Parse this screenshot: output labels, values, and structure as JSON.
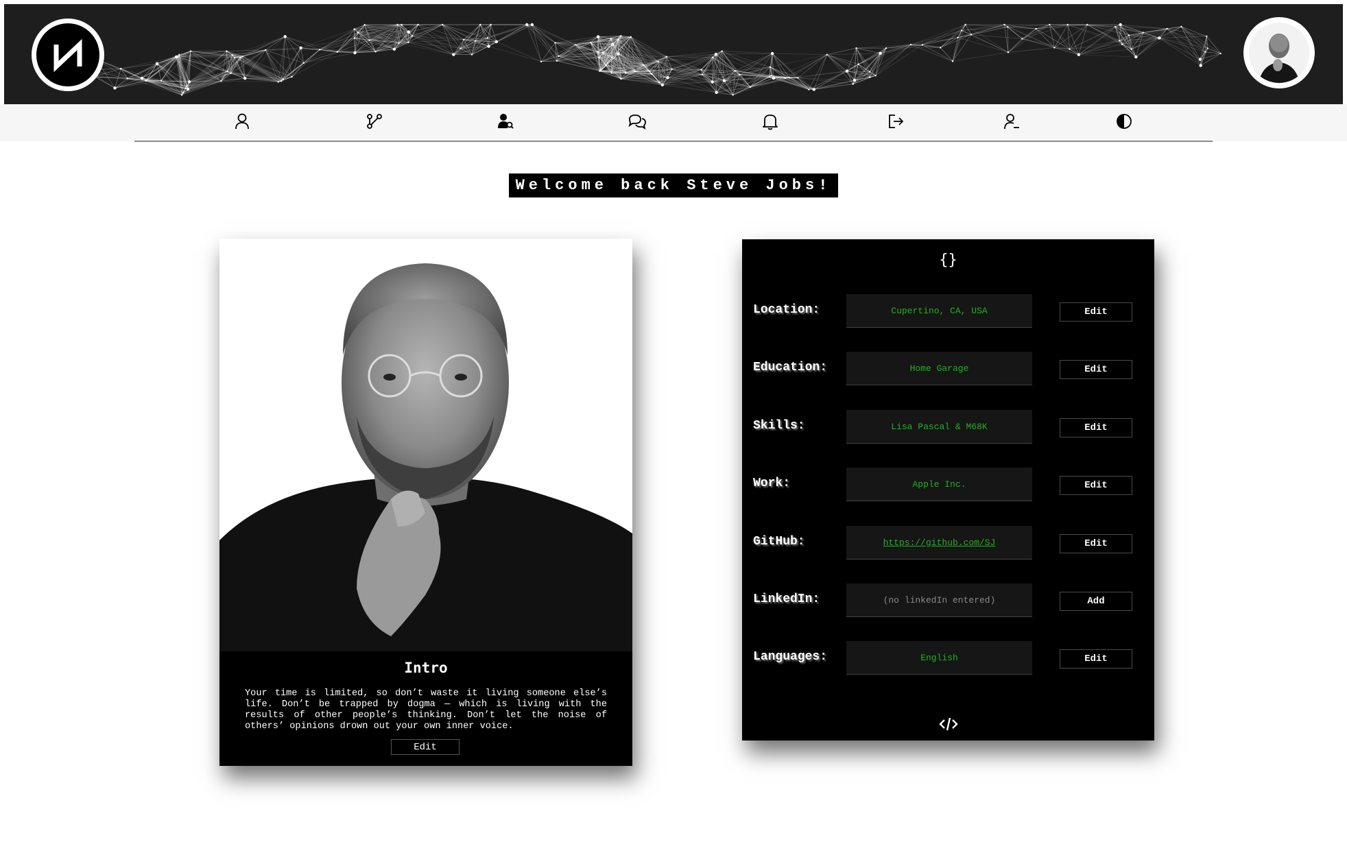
{
  "header": {
    "logo_icon": "brand-logo-icon",
    "avatar_icon": "user-avatar-photo"
  },
  "nav": {
    "items": [
      {
        "icon": "user-icon",
        "name": "nav-profile"
      },
      {
        "icon": "network-icon",
        "name": "nav-network"
      },
      {
        "icon": "user-search-icon",
        "name": "nav-find-users"
      },
      {
        "icon": "chat-icon",
        "name": "nav-messages"
      },
      {
        "icon": "bell-icon",
        "name": "nav-notifications"
      },
      {
        "icon": "logout-icon",
        "name": "nav-logout"
      },
      {
        "icon": "user-remove-icon",
        "name": "nav-delete-account"
      },
      {
        "icon": "contrast-icon",
        "name": "nav-theme-toggle"
      }
    ]
  },
  "welcome": {
    "text": "Welcome back Steve Jobs!"
  },
  "profile": {
    "intro_title": "Intro",
    "intro_text": "Your time is limited, so don’t waste it living someone else’s life. Don’t be trapped by dogma — which is living with the results of other people’s thinking. Don’t let the noise of others’ opinions drown out your own inner voice.",
    "edit_label": "Edit"
  },
  "info": {
    "top_icon_text": "{}",
    "bottom_icon": "code-icon",
    "rows": [
      {
        "label": "Location:",
        "value": "Cupertino, CA, USA",
        "button": "Edit"
      },
      {
        "label": "Education:",
        "value": "Home Garage",
        "button": "Edit"
      },
      {
        "label": "Skills:",
        "value": "Lisa Pascal & M68K",
        "button": "Edit"
      },
      {
        "label": "Work:",
        "value": "Apple Inc.",
        "button": "Edit"
      },
      {
        "label": "GitHub:",
        "value": "https://github.com/SJ",
        "button": "Edit"
      },
      {
        "label": "LinkedIn:",
        "value": "(no linkedIn entered)",
        "button": "Add"
      },
      {
        "label": "Languages:",
        "value": "English",
        "button": "Edit"
      }
    ]
  },
  "colors": {
    "value_text": "#1db31d",
    "card_bg": "#000000",
    "banner_bg": "#1e1e1e"
  }
}
